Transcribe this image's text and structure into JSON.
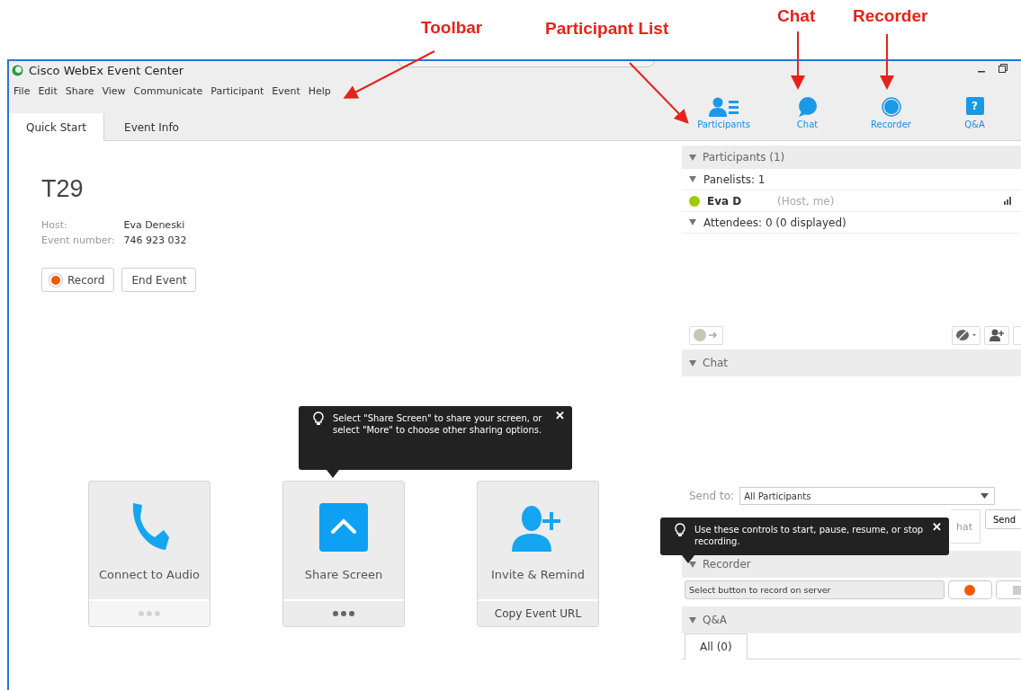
{
  "annotations": [
    {
      "label": "Toolbar"
    },
    {
      "label": "Participant List"
    },
    {
      "label": "Chat"
    },
    {
      "label": "Recorder"
    }
  ],
  "window": {
    "title": "Cisco WebEx Event Center"
  },
  "menu": [
    {
      "label": "File"
    },
    {
      "label": "Edit"
    },
    {
      "label": "Share"
    },
    {
      "label": "View"
    },
    {
      "label": "Communicate"
    },
    {
      "label": "Participant"
    },
    {
      "label": "Event"
    },
    {
      "label": "Help"
    }
  ],
  "tabs": [
    {
      "label": "Quick Start",
      "selected": true
    },
    {
      "label": "Event Info",
      "selected": false
    }
  ],
  "event": {
    "title": "T29",
    "details": [
      {
        "label": "Host:",
        "value": "Eva Deneski"
      },
      {
        "label": "Event number:",
        "value": "746 923 032"
      }
    ],
    "buttons": [
      {
        "kind": "record",
        "label": "Record"
      },
      {
        "kind": "plain",
        "label": "End Event"
      }
    ]
  },
  "share_tip": {
    "text": "Select \"Share Screen\" to share your screen, or select \"More\"  to choose other sharing options.",
    "close": "✕"
  },
  "cards": [
    {
      "kind": "audio",
      "label": "Connect to Audio",
      "footer": {
        "kind": "dots",
        "disabled": true
      }
    },
    {
      "kind": "share",
      "label": "Share Screen",
      "footer": {
        "kind": "dots",
        "disabled": false
      }
    },
    {
      "kind": "invite",
      "label": "Invite & Remind",
      "footer": {
        "kind": "text",
        "label": "Copy Event URL"
      }
    }
  ],
  "panel_nav": [
    {
      "kind": "participants",
      "label": "Participants"
    },
    {
      "kind": "chat",
      "label": "Chat"
    },
    {
      "kind": "recorder",
      "label": "Recorder"
    },
    {
      "kind": "qa",
      "label": "Q&A",
      "glyph": "?"
    }
  ],
  "participants": {
    "header": "Participants (1)",
    "expanded": true,
    "groups": [
      {
        "label": "Panelists: 1",
        "expanded": true,
        "members": [
          {
            "name": "Eva D",
            "role": "(Host, me)",
            "color": "#9ccc00"
          }
        ]
      },
      {
        "label": "Attendees: 0 (0 displayed)",
        "expanded": true
      }
    ]
  },
  "chat": {
    "header": "Chat",
    "expanded": true,
    "send_to_label": "Send to:",
    "send_to": "All Participants",
    "placeholder": "hat",
    "send": "Send"
  },
  "recorder_tip": {
    "text": "Use these controls to start, pause, resume, or stop recording.",
    "close": "✕"
  },
  "recorder": {
    "header": "Recorder",
    "expanded": true,
    "status": "Select button to record on server"
  },
  "qa": {
    "header": "Q&A",
    "expanded": true,
    "tabs": [
      {
        "label": "All (0)",
        "selected": true
      }
    ]
  }
}
